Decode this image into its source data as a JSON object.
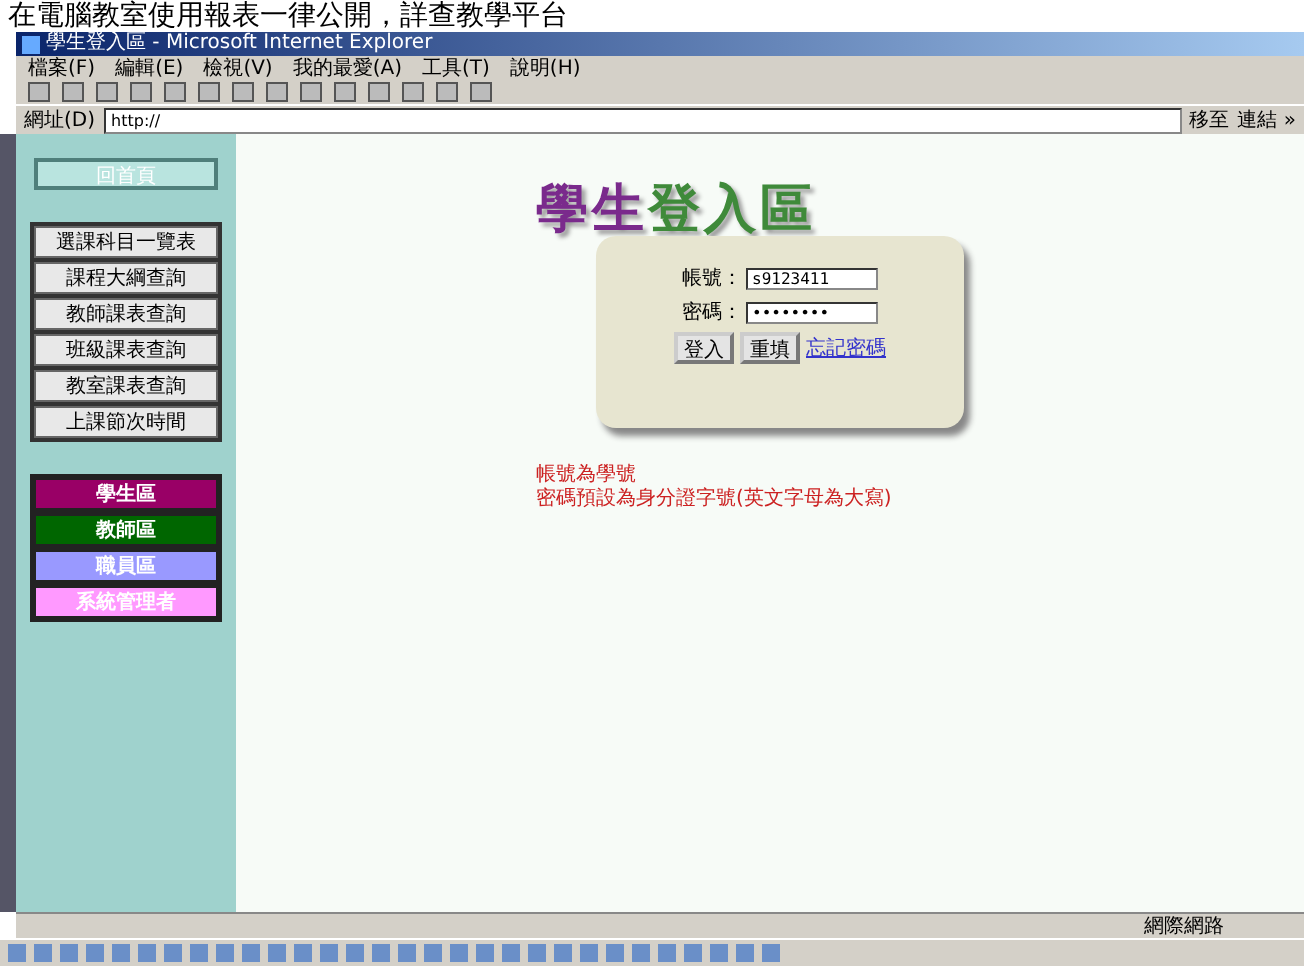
{
  "caption": "在電腦教室使用報表一律公開，詳查教學平台",
  "window": {
    "title": "學生登入區 - Microsoft Internet Explorer"
  },
  "menu": [
    "檔案(F)",
    "編輯(E)",
    "檢視(V)",
    "我的最愛(A)",
    "工具(T)",
    "說明(H)"
  ],
  "address": {
    "label": "網址(D)",
    "value": "http://",
    "go": "移至",
    "links": "連結 »"
  },
  "sidebar": {
    "home": "回首頁",
    "links": [
      "選課科目一覽表",
      "課程大綱查詢",
      "教師課表查詢",
      "班級課表查詢",
      "教室課表查詢",
      "上課節次時間"
    ],
    "areas": [
      {
        "label": "學生區",
        "color": "#990066"
      },
      {
        "label": "教師區",
        "color": "#006600"
      },
      {
        "label": "職員區",
        "color": "#9999ff"
      },
      {
        "label": "系統管理者",
        "color": "#ff99ff"
      }
    ]
  },
  "login": {
    "title": [
      {
        "text": "學",
        "color": "#7a2a8c"
      },
      {
        "text": "生",
        "color": "#7a2a8c"
      },
      {
        "text": "登",
        "color": "#3f8a3a"
      },
      {
        "text": "入",
        "color": "#3f8a3a"
      },
      {
        "text": "區",
        "color": "#3f8a3a"
      }
    ],
    "fields": [
      {
        "label": "帳號：",
        "value": "s9123411"
      },
      {
        "label": "密碼：",
        "value": "••••••••"
      }
    ],
    "buttons": [
      "登入",
      "重填"
    ],
    "link": "忘記密碼",
    "notes": [
      "帳號為學號",
      "密碼預設為身分證字號(英文字母為大寫)"
    ]
  },
  "status": {
    "zone": "網際網路"
  }
}
